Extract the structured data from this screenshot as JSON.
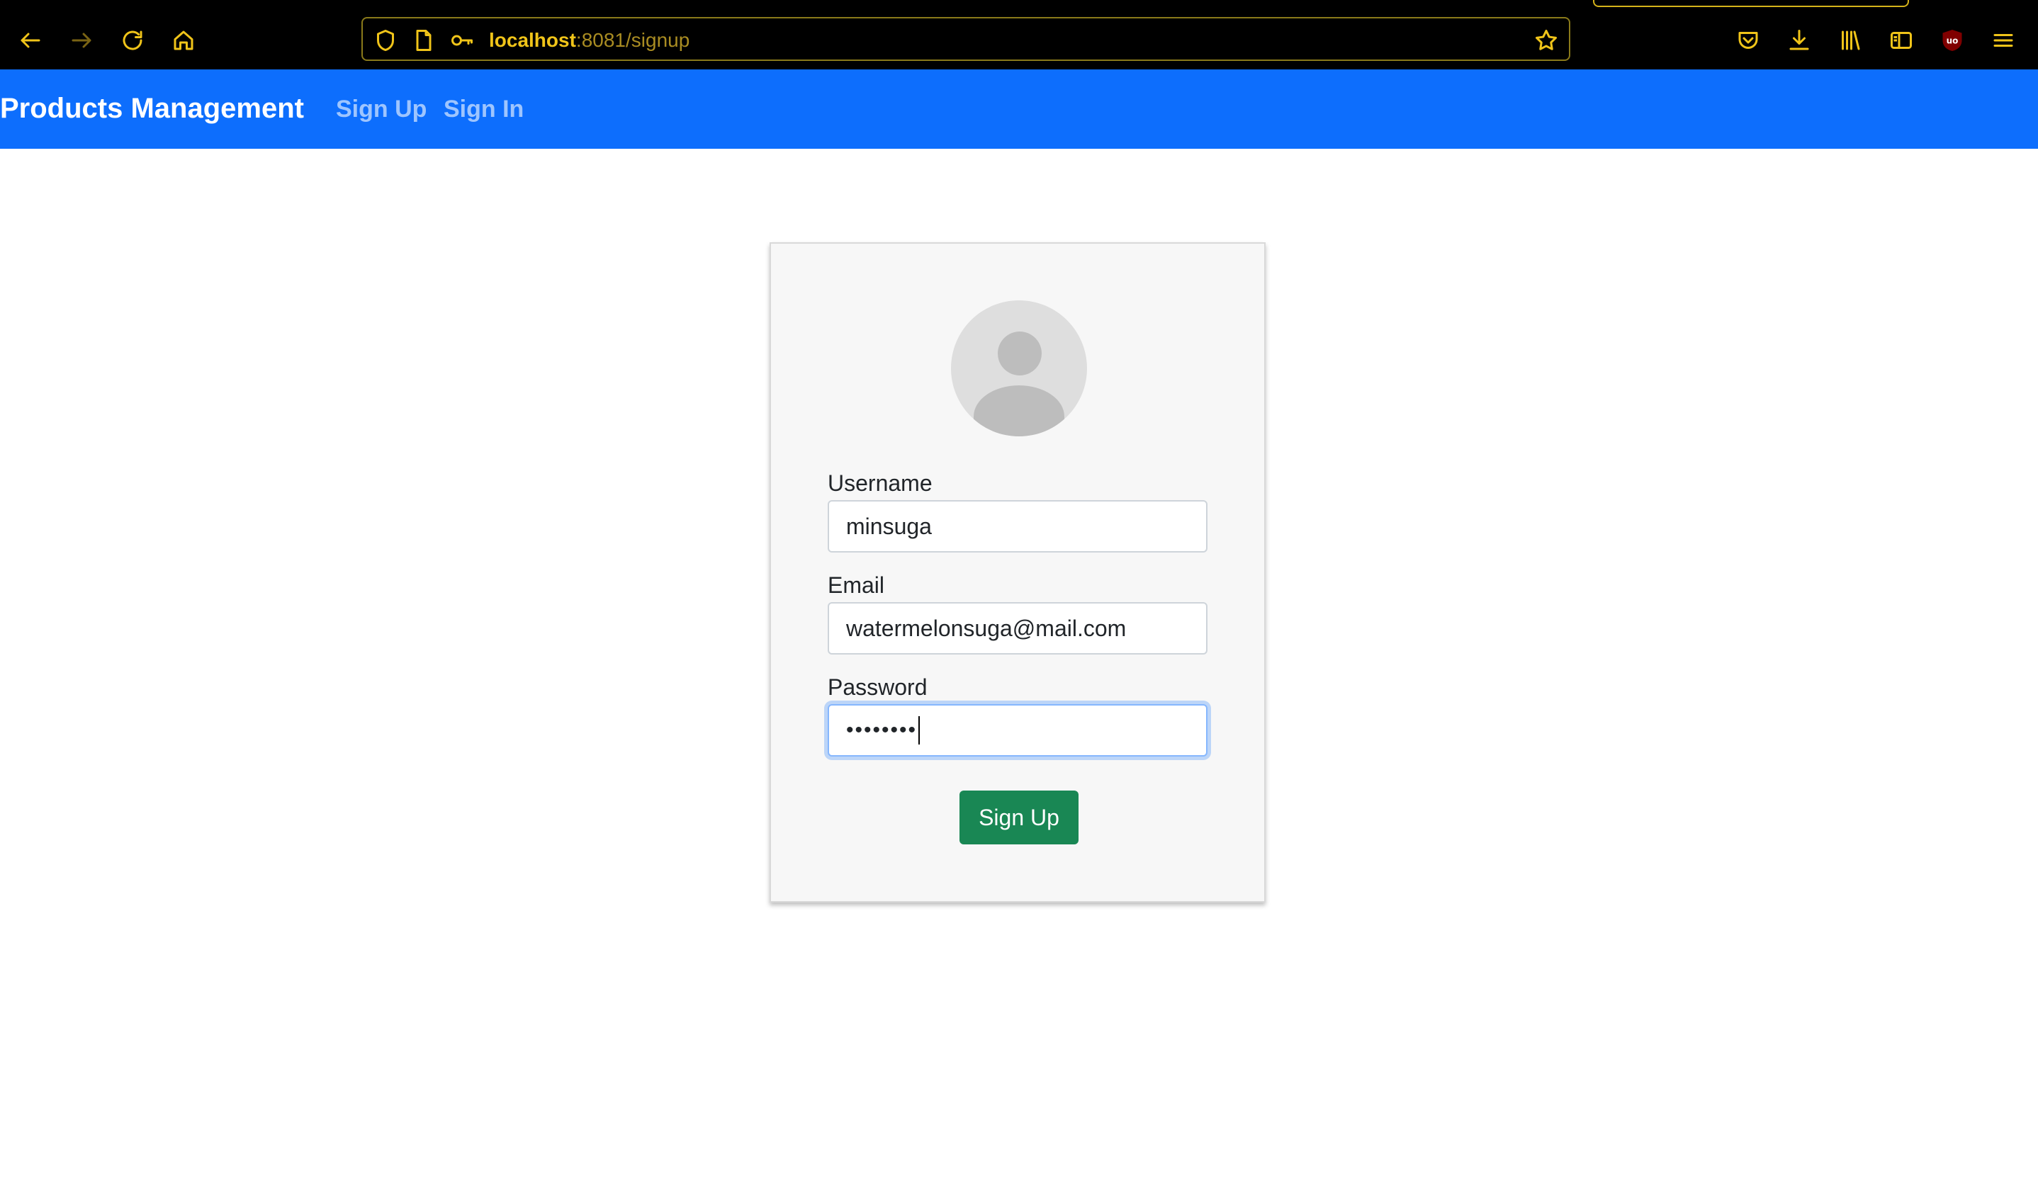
{
  "browser": {
    "url_host": "localhost",
    "url_rest": ":8081/signup",
    "icons": [
      "back-arrow-icon",
      "forward-arrow-icon",
      "reload-icon",
      "home-icon",
      "shield-icon",
      "page-icon",
      "key-icon",
      "star-icon",
      "pocket-icon",
      "download-icon",
      "library-icon",
      "sidebar-icon",
      "ublock-icon",
      "menu-icon"
    ],
    "accent_color": "#f0c419"
  },
  "navbar": {
    "brand": "Products Management",
    "links": [
      {
        "label": "Sign Up"
      },
      {
        "label": "Sign In"
      }
    ],
    "color": "#0d6efd"
  },
  "form": {
    "avatar_icon": "user-avatar-icon",
    "username_label": "Username",
    "username_value": "minsuga",
    "email_label": "Email",
    "email_value": "watermelonsuga@mail.com",
    "password_label": "Password",
    "password_masked": "••••••••",
    "submit_label": "Sign Up",
    "submit_color": "#198754"
  }
}
